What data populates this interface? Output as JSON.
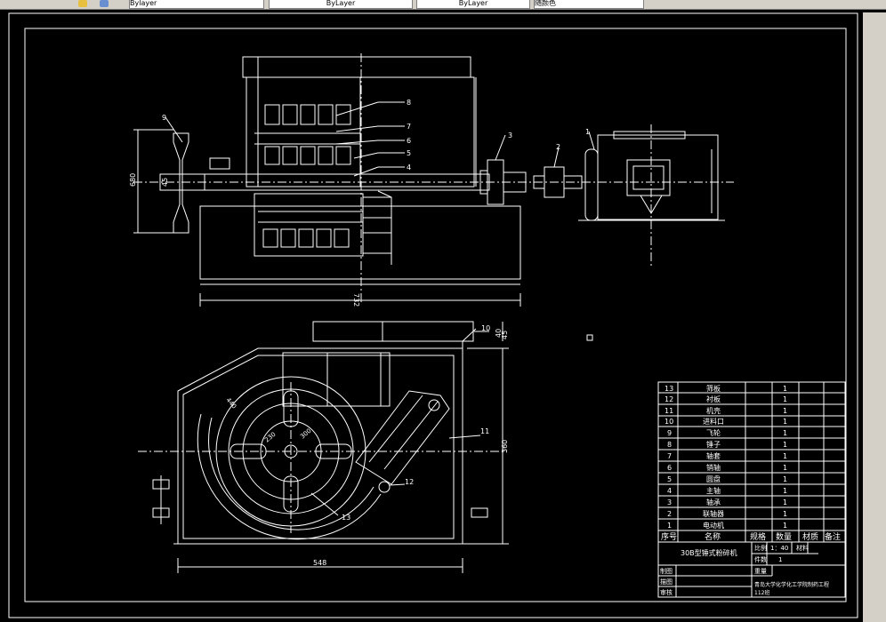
{
  "toolbar": {
    "tabs": [
      {
        "label": "Bylayer"
      },
      {
        "label": "ByLayer"
      },
      {
        "label": "ByLayer"
      },
      {
        "label": "随颜色"
      }
    ]
  },
  "drawing": {
    "title": "30B型锤式粉碎机",
    "dimensions": {
      "overall_width": "548",
      "height": "360",
      "top_width": "732",
      "flywheel": "680",
      "small_a": "45",
      "small_b": "40",
      "rotor_a": "440",
      "rotor_b": "230",
      "rotor_c": "300",
      "shaft": "45"
    },
    "callouts": [
      "1",
      "2",
      "3",
      "4",
      "5",
      "6",
      "7",
      "8",
      "9",
      "10",
      "11",
      "12",
      "13"
    ],
    "bom_header": {
      "no": "序号",
      "name": "名称",
      "spec": "规格",
      "qty": "数量",
      "material": "材质",
      "remark": "备注"
    },
    "bom_rows": [
      {
        "no": "13",
        "name": "筛板",
        "qty": "1"
      },
      {
        "no": "12",
        "name": "衬板",
        "qty": "1"
      },
      {
        "no": "11",
        "name": "机壳",
        "qty": "1"
      },
      {
        "no": "10",
        "name": "进料口",
        "qty": "1"
      },
      {
        "no": "9",
        "name": "飞轮",
        "qty": "1"
      },
      {
        "no": "8",
        "name": "锤子",
        "qty": "1"
      },
      {
        "no": "7",
        "name": "轴套",
        "qty": "1"
      },
      {
        "no": "6",
        "name": "销轴",
        "qty": "1"
      },
      {
        "no": "5",
        "name": "圆盘",
        "qty": "1"
      },
      {
        "no": "4",
        "name": "主轴",
        "qty": "1"
      },
      {
        "no": "3",
        "name": "轴承",
        "qty": "1"
      },
      {
        "no": "2",
        "name": "联轴器",
        "qty": "1"
      },
      {
        "no": "1",
        "name": "电动机",
        "qty": "1"
      }
    ],
    "title_block": {
      "scale_label": "比例",
      "scale_value": "1：40",
      "material_label": "材料",
      "count_label": "件数",
      "count_value": "1",
      "weight_label": "重量",
      "drawn": "制图",
      "drawn2": "描图",
      "checked": "审核",
      "school": "青岛大学化学化工学院制药工程",
      "class": "112班"
    }
  }
}
